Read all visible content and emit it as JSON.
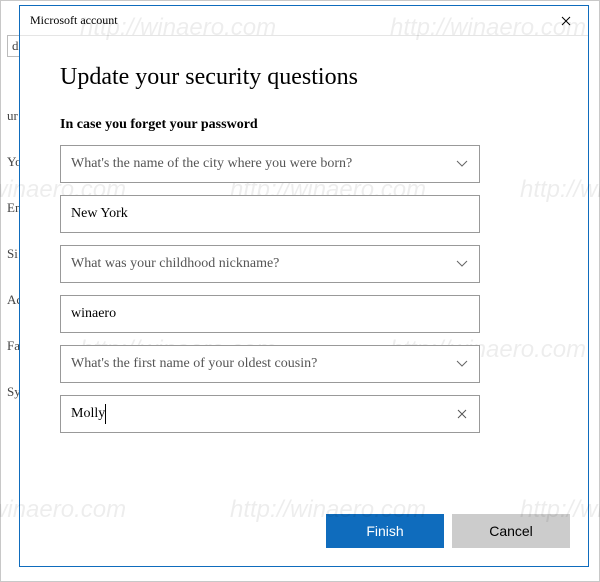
{
  "dialog": {
    "title": "Microsoft account",
    "heading": "Update your security questions",
    "subheading": "In case you forget your password",
    "questions": [
      {
        "prompt": "What's the name of the city where you were born?",
        "answer": "New York"
      },
      {
        "prompt": "What was your childhood nickname?",
        "answer": "winaero"
      },
      {
        "prompt": "What's the first name of your oldest cousin?",
        "answer": "Molly",
        "hasClear": true,
        "hasCaret": true
      }
    ],
    "buttons": {
      "primary": "Finish",
      "secondary": "Cancel"
    }
  },
  "background": {
    "field": "d",
    "items": [
      "ur",
      "Yo",
      "En",
      "Si",
      "Ac",
      "Fa",
      "Sy"
    ]
  },
  "watermark": "http://winaero.com"
}
